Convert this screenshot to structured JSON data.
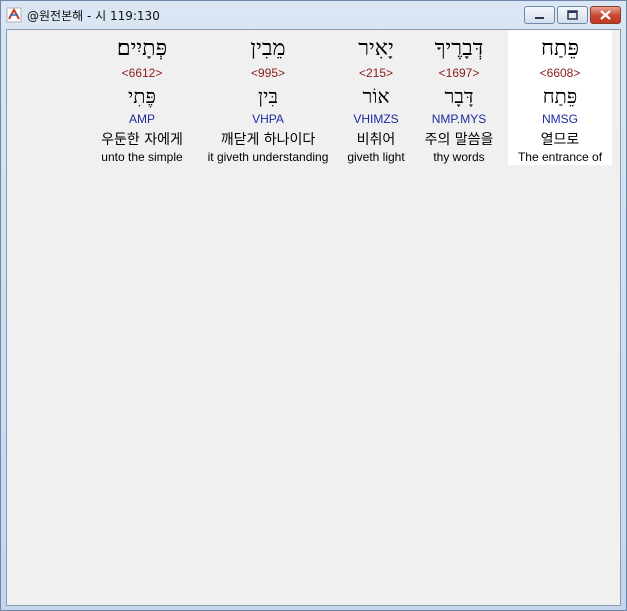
{
  "window": {
    "title": "@원전본해 - 시 119:130"
  },
  "columns": [
    {
      "hebrew": "פֵּתַח",
      "strong": "<6608>",
      "lemma": "פֵּתַח",
      "morph": "NMSG",
      "korean": "열므로",
      "english": "The entrance of",
      "highlighted": true
    },
    {
      "hebrew": "דְּבָרֶיךָ",
      "strong": "<1697>",
      "lemma": "דָּבָר",
      "morph": "NMP.MYS",
      "korean": "주의 말씀을",
      "english": "thy words",
      "highlighted": false
    },
    {
      "hebrew": "יָאִיר",
      "strong": "<215>",
      "lemma": "אוֹר",
      "morph": "VHIMZS",
      "korean": "비취어",
      "english": "giveth light",
      "highlighted": false
    },
    {
      "hebrew": "מֵבִין",
      "strong": "<995>",
      "lemma": "בִּין",
      "morph": "VHPA",
      "korean": "깨닫게 하나이다",
      "english": "it giveth understanding",
      "highlighted": false
    },
    {
      "hebrew": "פְּתָיִים׃",
      "strong": "<6612>",
      "lemma": "פֶּתִי",
      "morph": "AMP",
      "korean": "우둔한 자에게",
      "english": "unto the simple",
      "highlighted": false
    }
  ]
}
